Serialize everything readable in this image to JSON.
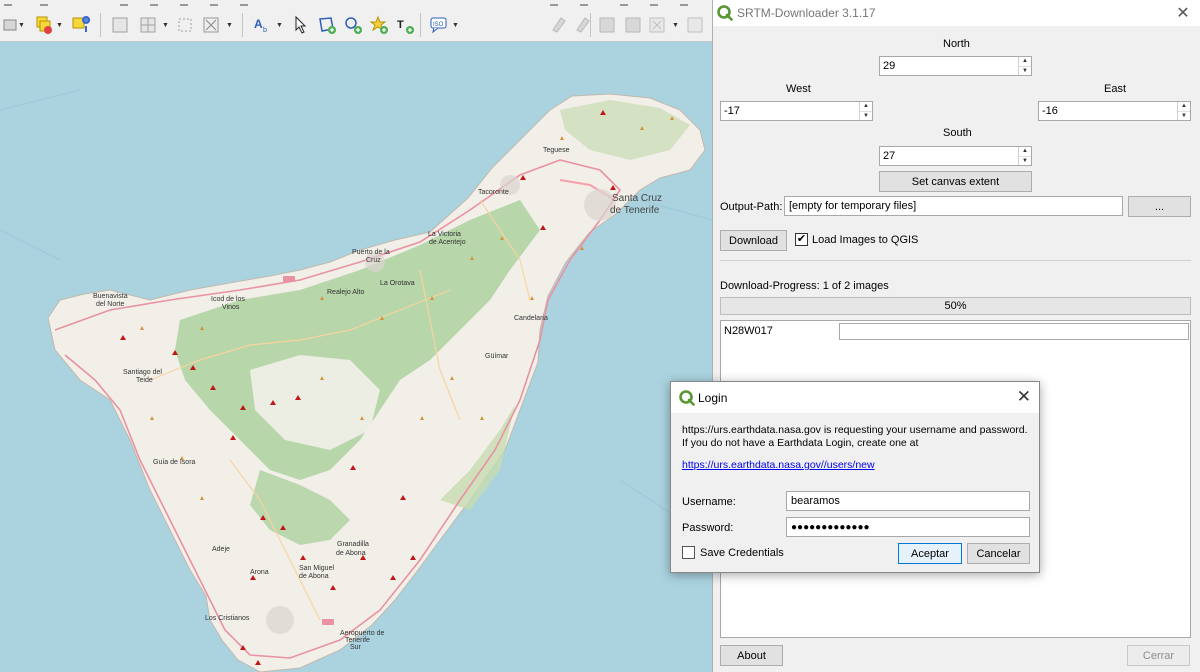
{
  "map": {
    "places": [
      {
        "name": "Teguese"
      },
      {
        "name": "Tacoronte"
      },
      {
        "name": "Santa Cruz"
      },
      {
        "name": "de Tenerife"
      },
      {
        "name": "La Victoria"
      },
      {
        "name": "de Acentejo"
      },
      {
        "name": "Puerto de la"
      },
      {
        "name": "Cruz"
      },
      {
        "name": "Realejo Alto"
      },
      {
        "name": "La Orotava"
      },
      {
        "name": "Buenavista"
      },
      {
        "name": "del Norte"
      },
      {
        "name": "Icod de los"
      },
      {
        "name": "Vinos"
      },
      {
        "name": "Candelaria"
      },
      {
        "name": "Güímar"
      },
      {
        "name": "Santiago del"
      },
      {
        "name": "Teide"
      },
      {
        "name": "Guía de Isora"
      },
      {
        "name": "Adeje"
      },
      {
        "name": "Granadilla"
      },
      {
        "name": "de Abona"
      },
      {
        "name": "Arona"
      },
      {
        "name": "San Miguel"
      },
      {
        "name": "de Abona"
      },
      {
        "name": "Los Cristianos"
      },
      {
        "name": "Aeropuerto de"
      },
      {
        "name": "Tenerife"
      },
      {
        "name": "Sur"
      }
    ]
  },
  "srtm": {
    "title": "SRTM-Downloader 3.1.17",
    "north_label": "North",
    "north_value": "29",
    "west_label": "West",
    "west_value": "-17",
    "east_label": "East",
    "east_value": "-16",
    "south_label": "South",
    "south_value": "27",
    "set_canvas_label": "Set canvas extent",
    "output_path_label": "Output-Path:",
    "output_path_value": "[empty for temporary files]",
    "browse_label": "...",
    "download_label": "Download",
    "load_images_label": "Load Images to QGIS",
    "load_images_checked": true,
    "progress_label": "Download-Progress: 1 of 2 images",
    "progress_percent": 50,
    "progress_text": "50%",
    "tile_name": "N28W017",
    "about_label": "About",
    "close_label": "Cerrar"
  },
  "login": {
    "title": "Login",
    "message": "https://urs.earthdata.nasa.gov is requesting your username and password. If you do not have a Earthdata Login, create one at",
    "link": "https://urs.earthdata.nasa.gov//users/new",
    "username_label": "Username:",
    "username_value": "bearamos",
    "password_label": "Password:",
    "password_value": "●●●●●●●●●●●●●",
    "save_credentials_label": "Save Credentials",
    "accept_label": "Aceptar",
    "cancel_label": "Cancelar"
  },
  "colors": {
    "sea": "#aad3df",
    "land": "#f2efe9",
    "forest": "#add19e",
    "accent_qgis": "#589632",
    "link": "#0000ee"
  }
}
